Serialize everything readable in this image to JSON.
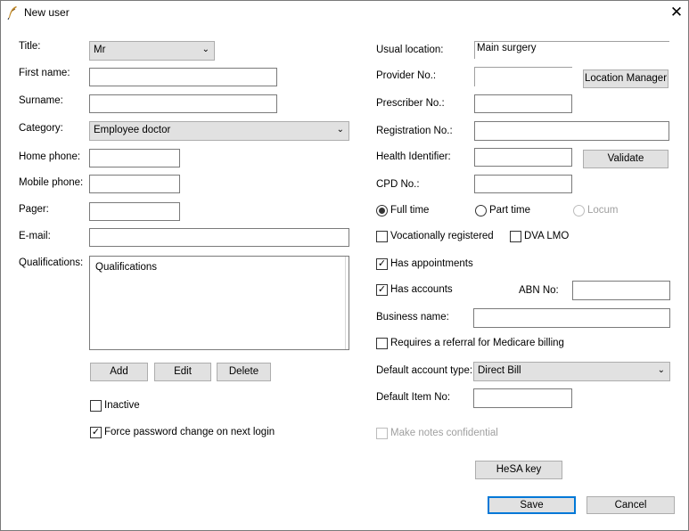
{
  "window": {
    "title": "New user"
  },
  "labels": {
    "title": "Title:",
    "first_name": "First name:",
    "surname": "Surname:",
    "category": "Category:",
    "home_phone": "Home phone:",
    "mobile_phone": "Mobile phone:",
    "pager": "Pager:",
    "email": "E-mail:",
    "qualifications": "Qualifications:",
    "usual_location": "Usual location:",
    "provider_no": "Provider No.:",
    "prescriber_no": "Prescriber No.:",
    "registration_no": "Registration No.:",
    "health_identifier": "Health Identifier:",
    "cpd_no": "CPD No.:",
    "abn_no": "ABN No:",
    "business_name": "Business name:",
    "default_account_type": "Default account type:",
    "default_item_no": "Default Item No:"
  },
  "values": {
    "title": "Mr",
    "category": "Employee doctor",
    "qualifications": "Qualifications",
    "usual_location": "Main surgery",
    "default_account_type": "Direct Bill"
  },
  "buttons": {
    "add": "Add",
    "edit": "Edit",
    "delete": "Delete",
    "location_manager": "Location Manager",
    "validate": "Validate",
    "hesa_key": "HeSA key",
    "save": "Save",
    "cancel": "Cancel"
  },
  "checkboxes": {
    "inactive": {
      "label": "Inactive",
      "checked": false
    },
    "force_password": {
      "label": "Force password change on next login",
      "checked": true
    },
    "vocationally_registered": {
      "label": "Vocationally registered",
      "checked": false
    },
    "dva_lmo": {
      "label": "DVA LMO",
      "checked": false
    },
    "has_appointments": {
      "label": "Has appointments",
      "checked": true
    },
    "has_accounts": {
      "label": "Has accounts",
      "checked": true
    },
    "requires_referral": {
      "label": "Requires a referral for Medicare billing",
      "checked": false
    },
    "notes_confidential": {
      "label": "Make notes confidential",
      "checked": false,
      "disabled": true
    }
  },
  "radios": {
    "full_time": {
      "label": "Full time",
      "selected": true
    },
    "part_time": {
      "label": "Part time",
      "selected": false
    },
    "locum": {
      "label": "Locum",
      "selected": false,
      "disabled": true
    }
  },
  "icons": {
    "app": "feather-pen-icon",
    "close": "close-icon",
    "dropdown": "chevron-down-icon",
    "check": "check-icon"
  }
}
